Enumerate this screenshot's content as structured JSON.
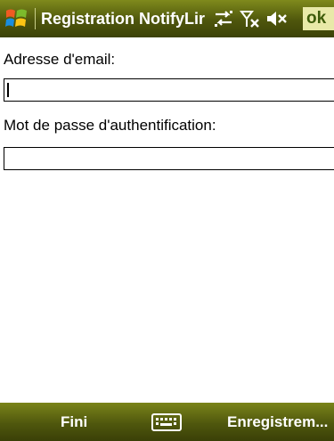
{
  "titlebar": {
    "title": "Registration NotifyLir",
    "ok_label": "ok",
    "icons": [
      "windows-start-icon",
      "connectivity-icon",
      "signal-off-icon",
      "speaker-muted-icon"
    ]
  },
  "form": {
    "email_label": "Adresse d'email:",
    "email_value": "",
    "password_label": "Mot de passe d'authentification:",
    "password_value": ""
  },
  "softkeys": {
    "left": "Fini",
    "right": "Enregistrem...",
    "center_icon": "keyboard-icon"
  },
  "colors": {
    "titlebar": "#5a6410",
    "softkey_bar": "#5a6410",
    "ok_bg": "#e8e9a8",
    "ok_text": "#3e5c0a"
  }
}
